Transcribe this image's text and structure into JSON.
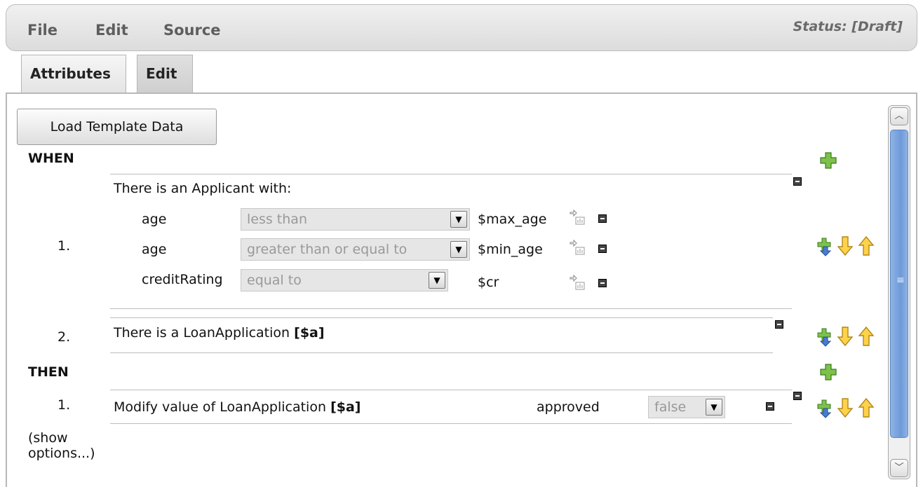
{
  "menu": {
    "file": "File",
    "edit": "Edit",
    "source": "Source",
    "status": "Status: [Draft]"
  },
  "tabs": {
    "attributes": "Attributes",
    "edit": "Edit"
  },
  "load_template_label": "Load Template Data",
  "when": {
    "header": "WHEN",
    "conditions": [
      {
        "number": "1.",
        "title": "There is an Applicant with:",
        "fields": [
          {
            "name": "age",
            "operator": "less than",
            "value": "$max_age"
          },
          {
            "name": "age",
            "operator": "greater than or equal to",
            "value": "$min_age"
          },
          {
            "name": "creditRating",
            "operator": "equal to",
            "value": "$cr"
          }
        ]
      },
      {
        "number": "2.",
        "title": "There is a LoanApplication",
        "binding": "[$a]"
      }
    ]
  },
  "then": {
    "header": "THEN",
    "actions": [
      {
        "number": "1.",
        "title": "Modify value of LoanApplication",
        "binding": "[$a]",
        "field": "approved",
        "value": "false"
      }
    ],
    "show_options_line1": "(show",
    "show_options_line2": "options...)"
  },
  "icons": {
    "add": "add-icon",
    "insert": "insert-icon",
    "move_down": "arrow-down-icon",
    "move_up": "arrow-up-icon",
    "remove": "remove-icon",
    "edit_value": "edit-value-icon"
  }
}
